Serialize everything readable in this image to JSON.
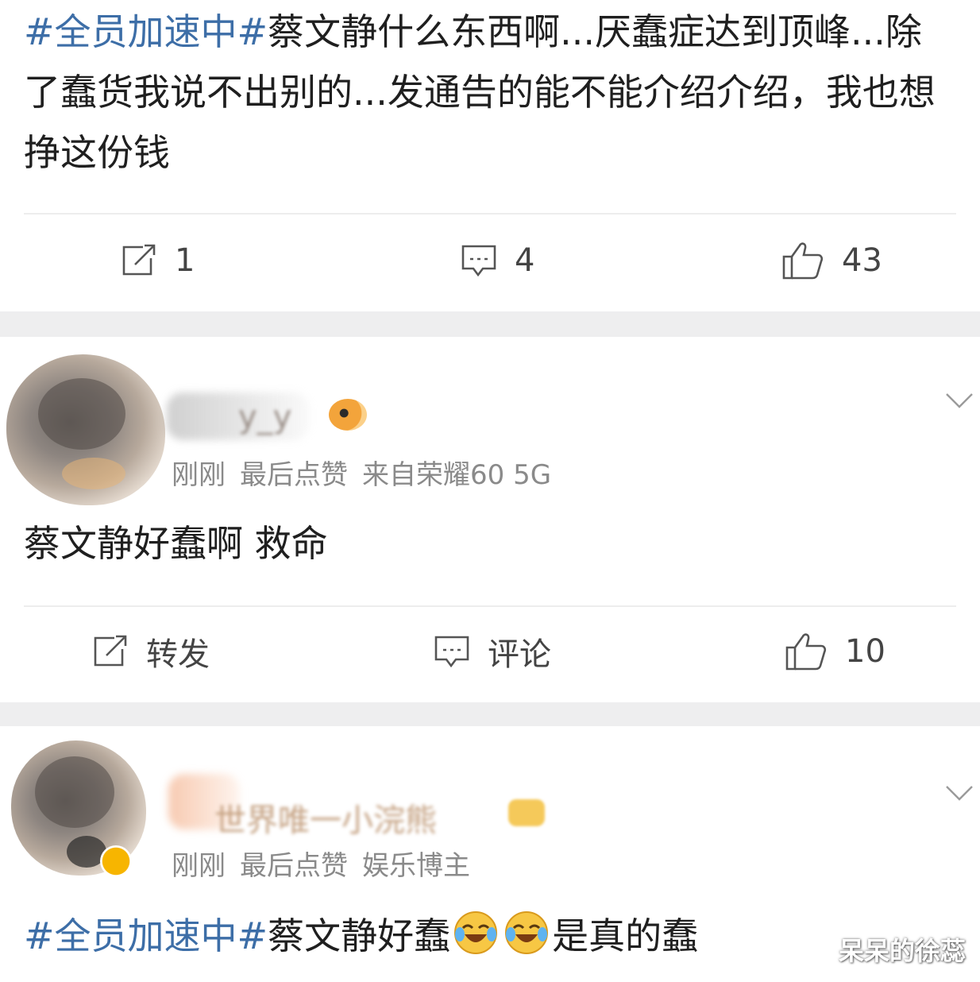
{
  "posts": [
    {
      "text_hashtag": "#全员加速中#",
      "text_body": "蔡文静什么东西啊...厌蠢症达到顶峰...除了蠢货我说不出别的...发通告的能不能介绍介绍，我也想挣这份钱",
      "actions": {
        "repost": "1",
        "comment": "4",
        "like": "43"
      }
    },
    {
      "username": "y_y",
      "meta": {
        "time": "刚刚",
        "status": "最后点赞",
        "source": "来自荣耀60 5G"
      },
      "text_body": "蔡文静好蠢啊 救命",
      "actions": {
        "repost": "转发",
        "comment": "评论",
        "like": "10"
      }
    },
    {
      "username": "世界唯一小浣熊",
      "meta": {
        "time": "刚刚",
        "status": "最后点赞",
        "role": "娱乐博主"
      },
      "text_hashtag": "#全员加速中#",
      "text_body_a": "蔡文静好蠢",
      "text_body_b": "是真的蠢"
    }
  ],
  "icons": {
    "repost": "repost-icon",
    "comment": "comment-icon",
    "like": "thumbs-up-icon",
    "more": "chevron-down-icon",
    "emoji": "laughing-crying-emoji",
    "vip": "vip-badge-icon",
    "verified": "verified-badge-icon"
  },
  "colors": {
    "hashtag": "#3d6ea7",
    "meta": "#8a8a8a",
    "card": "#ffffff",
    "gap": "#eeeeef"
  },
  "watermark": "呆呆的徐蕊"
}
